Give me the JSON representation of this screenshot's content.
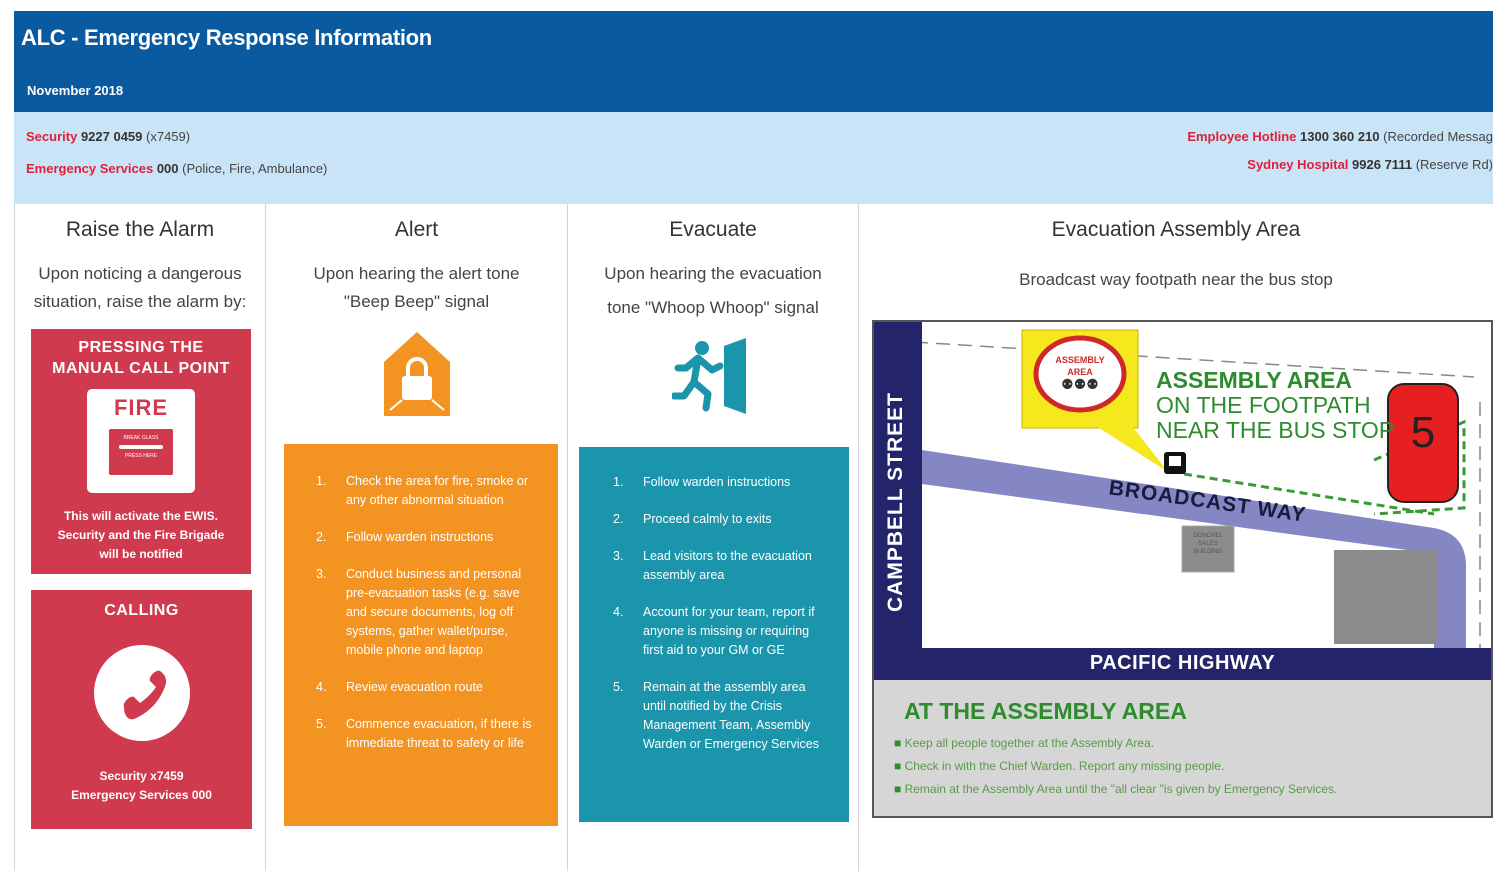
{
  "header": {
    "title": "ALC - Emergency Response Information",
    "date": "November 2018"
  },
  "contacts": {
    "security": {
      "label": "Security",
      "number": "9227 0459",
      "detail": "(x7459)"
    },
    "emergency": {
      "label": "Emergency Services",
      "number": "000",
      "detail": "(Police, Fire, Ambulance)"
    },
    "hotline": {
      "label": "Employee Hotline",
      "number": "1300 360 210",
      "detail": "(Recorded Messag"
    },
    "hospital": {
      "label": "Sydney Hospital",
      "number": "9926 7111",
      "detail": "(Reserve Rd)"
    }
  },
  "raise": {
    "heading": "Raise the Alarm",
    "desc_line1": "Upon noticing a dangerous",
    "desc_line2": "situation, raise the alarm by:",
    "box1": {
      "title_line1": "PRESSING THE",
      "title_line2": "MANUAL CALL POINT",
      "sign_word": "FIRE",
      "sign_small1": "BREAK GLASS",
      "sign_small2": "PRESS HERE",
      "note_line1": "This will activate the EWIS.",
      "note_line2": "Security and the Fire Brigade",
      "note_line3": "will be notified"
    },
    "box2": {
      "title": "CALLING",
      "line1": "Security x7459",
      "line2": "Emergency Services 000"
    }
  },
  "alert": {
    "heading": "Alert",
    "desc_line1": "Upon hearing the alert tone",
    "desc_line2": "\"Beep Beep\" signal",
    "icon": "house-lock-icon",
    "items": [
      {
        "n": "1.",
        "text": "Check the area for fire, smoke or any other abnormal situation"
      },
      {
        "n": "2.",
        "text": "Follow warden instructions"
      },
      {
        "n": "3.",
        "text": "Conduct business and personal pre-evacuation tasks (e.g. save and secure documents, log off systems, gather wallet/purse, mobile phone and laptop"
      },
      {
        "n": "4.",
        "text": "Review evacuation route"
      },
      {
        "n": "5.",
        "text": "Commence evacuation, if there is immediate threat to safety or life"
      }
    ],
    "color": "#f39322"
  },
  "evacuate": {
    "heading": "Evacuate",
    "desc_line1": "Upon hearing the evacuation",
    "desc_line2": "tone \"Whoop Whoop\" signal",
    "icon": "running-exit-icon",
    "items": [
      {
        "n": "1.",
        "text": "Follow warden instructions"
      },
      {
        "n": "2.",
        "text": "Proceed calmly to exits"
      },
      {
        "n": "3.",
        "text": "Lead visitors to the evacuation assembly area"
      },
      {
        "n": "4.",
        "text": "Account for your team, report if anyone is missing or requiring first aid to your GM or GE"
      },
      {
        "n": "5.",
        "text": "Remain at the assembly area until notified by the Crisis Management Team, Assembly Warden or Emergency Services"
      }
    ],
    "color": "#1b95ab"
  },
  "assembly": {
    "heading": "Evacuation Assembly Area",
    "desc": "Broadcast way footpath near the bus stop",
    "map": {
      "street_left": "CAMPBELL STREET",
      "street_mid": "BROADCAST WAY",
      "street_bottom": "PACIFIC HIGHWAY",
      "sign_top": "ASSEMBLY",
      "sign_bottom": "AREA",
      "callout_line1": "ASSEMBLY AREA",
      "callout_line2": "ON THE FOOTPATH",
      "callout_line3": "NEAR THE BUS STOP",
      "marker": "5",
      "building_line1": "DONCHEL",
      "building_line2": "SALES",
      "building_line3": "BUILDING"
    },
    "panel": {
      "title": "AT THE ASSEMBLY AREA",
      "bullets": [
        "Keep all people together at the Assembly Area.",
        "Check in with the Chief Warden. Report any missing people.",
        "Remain at the Assembly Area until the \"all clear \"is given by Emergency Services."
      ]
    }
  }
}
